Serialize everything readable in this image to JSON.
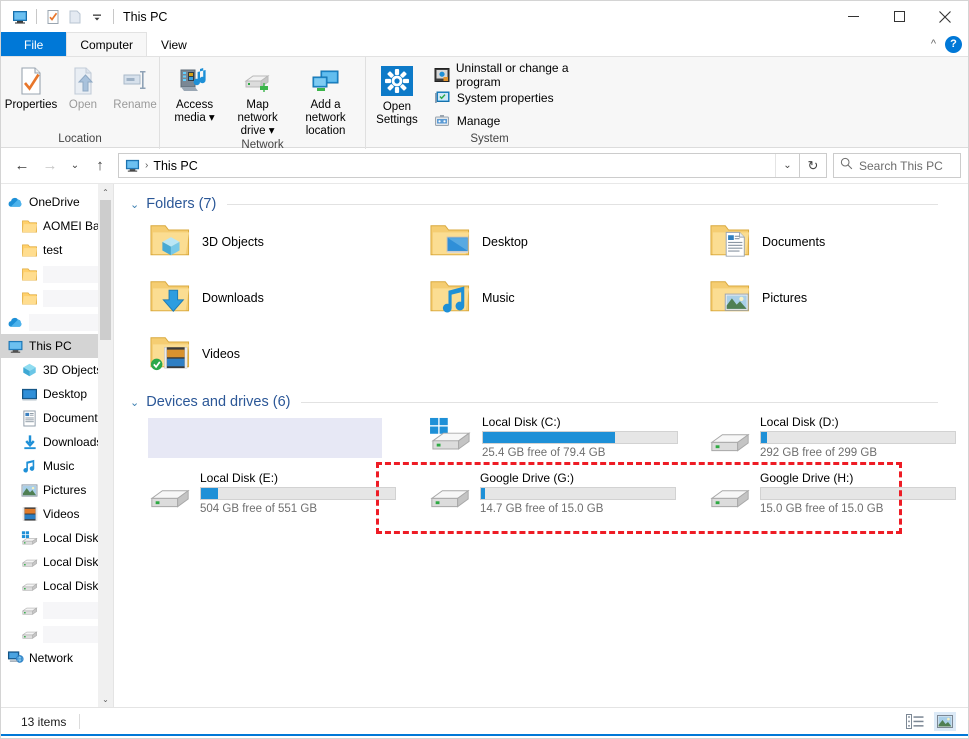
{
  "window": {
    "title": "This PC",
    "quick_access": [
      {
        "name": "this-pc-icon",
        "label": "This PC"
      },
      {
        "name": "properties-icon",
        "label": "Properties"
      },
      {
        "name": "new-folder-icon",
        "label": "New folder"
      },
      {
        "name": "customize-dropdown-icon",
        "label": "Customize Quick Access Toolbar"
      }
    ],
    "controls": {
      "minimize": "─",
      "maximize": "□",
      "close": "✕"
    }
  },
  "ribbon": {
    "tabs": [
      {
        "label": "File",
        "type": "file"
      },
      {
        "label": "Computer",
        "type": "active"
      },
      {
        "label": "View",
        "type": "normal"
      }
    ],
    "collapse_label": "^",
    "help_label": "?",
    "groups": [
      {
        "label": "Location",
        "buttons": [
          {
            "label": "Properties",
            "icon": "properties-icon",
            "disabled": false
          },
          {
            "label": "Open",
            "icon": "open-icon",
            "disabled": true
          },
          {
            "label": "Rename",
            "icon": "rename-icon",
            "disabled": true
          }
        ]
      },
      {
        "label": "Network",
        "buttons": [
          {
            "label": "Access media",
            "icon": "access-media-icon",
            "dropdown": true
          },
          {
            "label": "Map network drive",
            "icon": "map-network-drive-icon",
            "dropdown": true
          },
          {
            "label": "Add a network location",
            "icon": "add-network-location-icon",
            "dropdown": false
          }
        ]
      },
      {
        "label": "System",
        "big": {
          "label": "Open Settings",
          "icon": "gear-icon"
        },
        "items": [
          {
            "label": "Uninstall or change a program",
            "icon": "uninstall-program-icon"
          },
          {
            "label": "System properties",
            "icon": "system-properties-icon"
          },
          {
            "label": "Manage",
            "icon": "manage-icon"
          }
        ]
      }
    ]
  },
  "addressbar": {
    "back": "←",
    "forward": "→",
    "recent": "⌄",
    "up": "↑",
    "breadcrumb": {
      "icon": "this-pc-icon",
      "label": "This PC",
      "separator": "›"
    },
    "dropdown": "⌄",
    "refresh": "↻",
    "search_placeholder": "Search This PC"
  },
  "navpane": {
    "items": [
      {
        "label": "OneDrive",
        "icon": "onedrive-icon",
        "indent": 0,
        "redacted": false,
        "selected": false
      },
      {
        "label": "AOMEI Bac",
        "icon": "folder-icon",
        "indent": 1,
        "redacted": false,
        "selected": false
      },
      {
        "label": "test",
        "icon": "folder-icon",
        "indent": 1,
        "redacted": false,
        "selected": false
      },
      {
        "label": "",
        "icon": "folder-icon",
        "indent": 1,
        "redacted": true,
        "selected": false
      },
      {
        "label": "",
        "icon": "folder-icon",
        "indent": 1,
        "redacted": true,
        "selected": false
      },
      {
        "label": "",
        "icon": "onedrive-icon",
        "indent": 0,
        "redacted": true,
        "selected": false
      },
      {
        "label": "This PC",
        "icon": "this-pc-icon",
        "indent": 0,
        "redacted": false,
        "selected": true
      },
      {
        "label": "3D Objects",
        "icon": "3d-objects-icon",
        "indent": 1,
        "redacted": false,
        "selected": false
      },
      {
        "label": "Desktop",
        "icon": "desktop-icon",
        "indent": 1,
        "redacted": false,
        "selected": false
      },
      {
        "label": "Document",
        "icon": "documents-icon",
        "indent": 1,
        "redacted": false,
        "selected": false
      },
      {
        "label": "Downloads",
        "icon": "downloads-icon",
        "indent": 1,
        "redacted": false,
        "selected": false
      },
      {
        "label": "Music",
        "icon": "music-icon",
        "indent": 1,
        "redacted": false,
        "selected": false
      },
      {
        "label": "Pictures",
        "icon": "pictures-icon",
        "indent": 1,
        "redacted": false,
        "selected": false
      },
      {
        "label": "Videos",
        "icon": "videos-icon",
        "indent": 1,
        "redacted": false,
        "selected": false
      },
      {
        "label": "Local Disk",
        "icon": "windows-drive-icon",
        "indent": 1,
        "redacted": false,
        "selected": false
      },
      {
        "label": "Local Disk",
        "icon": "drive-icon",
        "indent": 1,
        "redacted": false,
        "selected": false
      },
      {
        "label": "Local Disk",
        "icon": "drive-icon",
        "indent": 1,
        "redacted": false,
        "selected": false
      },
      {
        "label": "",
        "icon": "drive-icon",
        "indent": 1,
        "redacted": true,
        "selected": false
      },
      {
        "label": "",
        "icon": "drive-icon",
        "indent": 1,
        "redacted": true,
        "selected": false
      },
      {
        "label": "Network",
        "icon": "network-icon",
        "indent": 0,
        "redacted": false,
        "selected": false
      }
    ],
    "scroll_up": "⌃",
    "scroll_down": "⌄"
  },
  "content": {
    "folders_group": {
      "chevron": "⌄",
      "title": "Folders (7)",
      "items": [
        {
          "name": "3D Objects",
          "icon": "folder-3d-objects-icon"
        },
        {
          "name": "Desktop",
          "icon": "folder-desktop-icon"
        },
        {
          "name": "Documents",
          "icon": "folder-documents-icon"
        },
        {
          "name": "Downloads",
          "icon": "folder-downloads-icon"
        },
        {
          "name": "Music",
          "icon": "folder-music-icon"
        },
        {
          "name": "Pictures",
          "icon": "folder-pictures-icon"
        },
        {
          "name": "Videos",
          "icon": "folder-videos-icon",
          "badge": "sync-ok-badge"
        }
      ]
    },
    "drives_group": {
      "chevron": "⌄",
      "title": "Devices and drives (6)",
      "items": [
        {
          "name": "",
          "free_text": "",
          "icon": "drive-icon",
          "used_pct": 0,
          "redacted": true
        },
        {
          "name": "Local Disk (C:)",
          "free_text": "25.4 GB free of 79.4 GB",
          "icon": "windows-drive-icon",
          "used_pct": 68,
          "redacted": false
        },
        {
          "name": "Local Disk (D:)",
          "free_text": "292 GB free of 299 GB",
          "icon": "drive-icon",
          "used_pct": 3,
          "redacted": false
        },
        {
          "name": "Local Disk (E:)",
          "free_text": "504 GB free of 551 GB",
          "icon": "drive-icon",
          "used_pct": 9,
          "redacted": false
        },
        {
          "name": "Google Drive (G:)",
          "free_text": "14.7 GB free of 15.0 GB",
          "icon": "drive-icon",
          "used_pct": 2,
          "redacted": false
        },
        {
          "name": "Google Drive (H:)",
          "free_text": "15.0 GB free of 15.0 GB",
          "icon": "drive-icon",
          "used_pct": 0,
          "redacted": false
        }
      ]
    },
    "annotation": {
      "type": "red-dashed-rectangle",
      "color": "#ee1c25",
      "encloses": [
        "Google Drive (G:)",
        "Google Drive (H:)"
      ]
    }
  },
  "statusbar": {
    "item_count": "13 items",
    "views": [
      {
        "name": "details-view-button",
        "label": "Details view",
        "active": false
      },
      {
        "name": "large-icons-view-button",
        "label": "Large icons view",
        "active": true
      }
    ]
  }
}
